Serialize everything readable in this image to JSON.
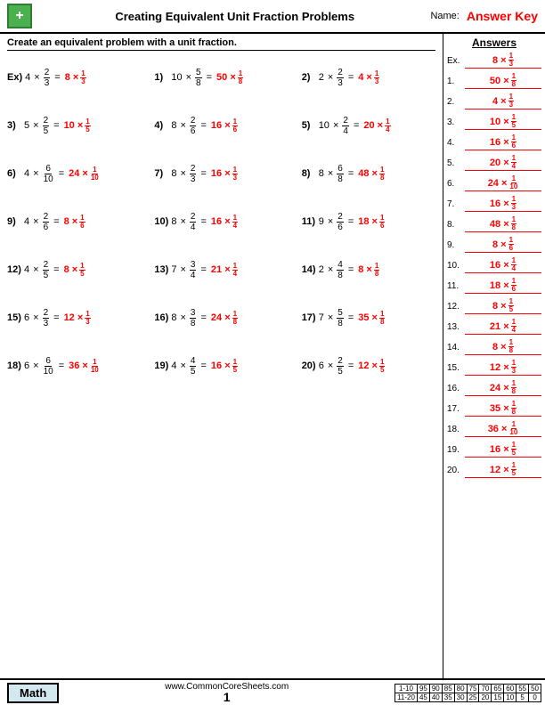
{
  "header": {
    "title": "Creating Equivalent Unit Fraction Problems",
    "name_label": "Name:",
    "answer_key": "Answer Key",
    "logo_symbol": "+"
  },
  "instruction": "Create an equivalent problem with a unit fraction.",
  "example": {
    "label": "Ex)",
    "problem": "4 × 2/3 = 8 × 1/3"
  },
  "problems": [
    {
      "num": "1)",
      "problem": "10 × 5/8 = 50 × 1/8"
    },
    {
      "num": "2)",
      "problem": "2 × 2/3 = 4 × 1/3"
    },
    {
      "num": "3)",
      "problem": "5 × 2/5 = 10 × 1/5"
    },
    {
      "num": "4)",
      "problem": "8 × 2/6 = 16 × 1/6"
    },
    {
      "num": "5)",
      "problem": "10 × 2/4 = 20 × 1/4"
    },
    {
      "num": "6)",
      "problem": "4 × 6/10 = 24 × 1/10"
    },
    {
      "num": "7)",
      "problem": "8 × 2/3 = 16 × 1/3"
    },
    {
      "num": "8)",
      "problem": "8 × 6/8 = 48 × 1/8"
    },
    {
      "num": "9)",
      "problem": "4 × 2/6 = 8 × 1/6"
    },
    {
      "num": "10)",
      "problem": "8 × 2/4 = 16 × 1/4"
    },
    {
      "num": "11)",
      "problem": "9 × 2/6 = 18 × 1/6"
    },
    {
      "num": "12)",
      "problem": "4 × 2/5 = 8 × 1/5"
    },
    {
      "num": "13)",
      "problem": "7 × 3/4 = 21 × 1/4"
    },
    {
      "num": "14)",
      "problem": "2 × 4/8 = 8 × 1/8"
    },
    {
      "num": "15)",
      "problem": "6 × 2/3 = 12 × 1/3"
    },
    {
      "num": "16)",
      "problem": "8 × 3/8 = 24 × 1/8"
    },
    {
      "num": "17)",
      "problem": "7 × 5/8 = 35 × 1/8"
    },
    {
      "num": "18)",
      "problem": "6 × 6/10 = 36 × 1/10"
    },
    {
      "num": "19)",
      "problem": "4 × 4/5 = 16 × 1/5"
    },
    {
      "num": "20)",
      "problem": "6 × 2/5 = 12 × 1/5"
    }
  ],
  "answers": {
    "title": "Answers",
    "items": [
      {
        "num": "Ex.",
        "val": "8 × 1/3"
      },
      {
        "num": "1.",
        "val": "50 × 1/8"
      },
      {
        "num": "2.",
        "val": "4 × 1/3"
      },
      {
        "num": "3.",
        "val": "10 × 1/5"
      },
      {
        "num": "4.",
        "val": "16 × 1/6"
      },
      {
        "num": "5.",
        "val": "20 × 1/4"
      },
      {
        "num": "6.",
        "val": "24 × 1/10"
      },
      {
        "num": "7.",
        "val": "16 × 1/3"
      },
      {
        "num": "8.",
        "val": "48 × 1/8"
      },
      {
        "num": "9.",
        "val": "8 × 1/6"
      },
      {
        "num": "10.",
        "val": "16 × 1/4"
      },
      {
        "num": "11.",
        "val": "18 × 1/6"
      },
      {
        "num": "12.",
        "val": "8 × 1/5"
      },
      {
        "num": "13.",
        "val": "21 × 1/4"
      },
      {
        "num": "14.",
        "val": "8 × 1/8"
      },
      {
        "num": "15.",
        "val": "12 × 1/3"
      },
      {
        "num": "16.",
        "val": "24 × 1/8"
      },
      {
        "num": "17.",
        "val": "35 × 1/8"
      },
      {
        "num": "18.",
        "val": "36 × 1/10"
      },
      {
        "num": "19.",
        "val": "16 × 1/5"
      },
      {
        "num": "20.",
        "val": "12 × 1/5"
      }
    ]
  },
  "footer": {
    "math_label": "Math",
    "url": "www.CommonCoreSheets.com",
    "page": "1",
    "stats": {
      "rows": [
        "1-10",
        "11-20"
      ],
      "cols": [
        "95",
        "90",
        "85",
        "80",
        "75",
        "70",
        "65",
        "60",
        "55",
        "50"
      ],
      "row1": [
        "95",
        "90",
        "85",
        "80",
        "75",
        "70",
        "65",
        "60",
        "55",
        "50"
      ],
      "row2": [
        "45",
        "40",
        "35",
        "30",
        "25",
        "20",
        "15",
        "10",
        "5",
        "0"
      ]
    }
  }
}
